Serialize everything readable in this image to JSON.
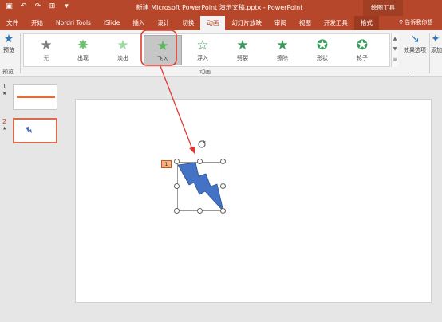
{
  "title_bar": {
    "title": "新建 Microsoft PowerPoint 演示文稿.pptx - PowerPoint",
    "tools_tab": "绘图工具"
  },
  "tabs": [
    {
      "label": "文件"
    },
    {
      "label": "开始"
    },
    {
      "label": "Nordri Tools"
    },
    {
      "label": "iSlide"
    },
    {
      "label": "插入"
    },
    {
      "label": "设计"
    },
    {
      "label": "切换"
    },
    {
      "label": "动画",
      "active": true
    },
    {
      "label": "幻灯片放映"
    },
    {
      "label": "审阅"
    },
    {
      "label": "视图"
    },
    {
      "label": "开发工具"
    },
    {
      "label": "格式"
    }
  ],
  "tell_me": "告诉我你想",
  "ribbon": {
    "preview_label": "预览",
    "preview_group": "预览",
    "animation_group": "动画",
    "effect_options": "效果选项",
    "add_animation": "添加动画",
    "animations": [
      {
        "label": "无",
        "color": "#7f7f7f"
      },
      {
        "label": "出现",
        "color": "#5cb85c"
      },
      {
        "label": "淡出",
        "color": "#5cb85c"
      },
      {
        "label": "飞入",
        "color": "#5cb85c",
        "selected": true
      },
      {
        "label": "浮入",
        "color": "#3a9a5c"
      },
      {
        "label": "劈裂",
        "color": "#3a9a5c"
      },
      {
        "label": "擦除",
        "color": "#3a9a5c"
      },
      {
        "label": "形状",
        "color": "#3a9a5c"
      },
      {
        "label": "轮子",
        "color": "#3a9a5c"
      }
    ]
  },
  "slides": [
    {
      "number": "1",
      "marker": "★"
    },
    {
      "number": "2",
      "marker": "★",
      "current": true
    }
  ],
  "slide_canvas": {
    "animation_tag": "1"
  },
  "colors": {
    "accent": "#b7472a",
    "highlight_circle": "#e03a2f",
    "bolt": "#4472c4"
  }
}
